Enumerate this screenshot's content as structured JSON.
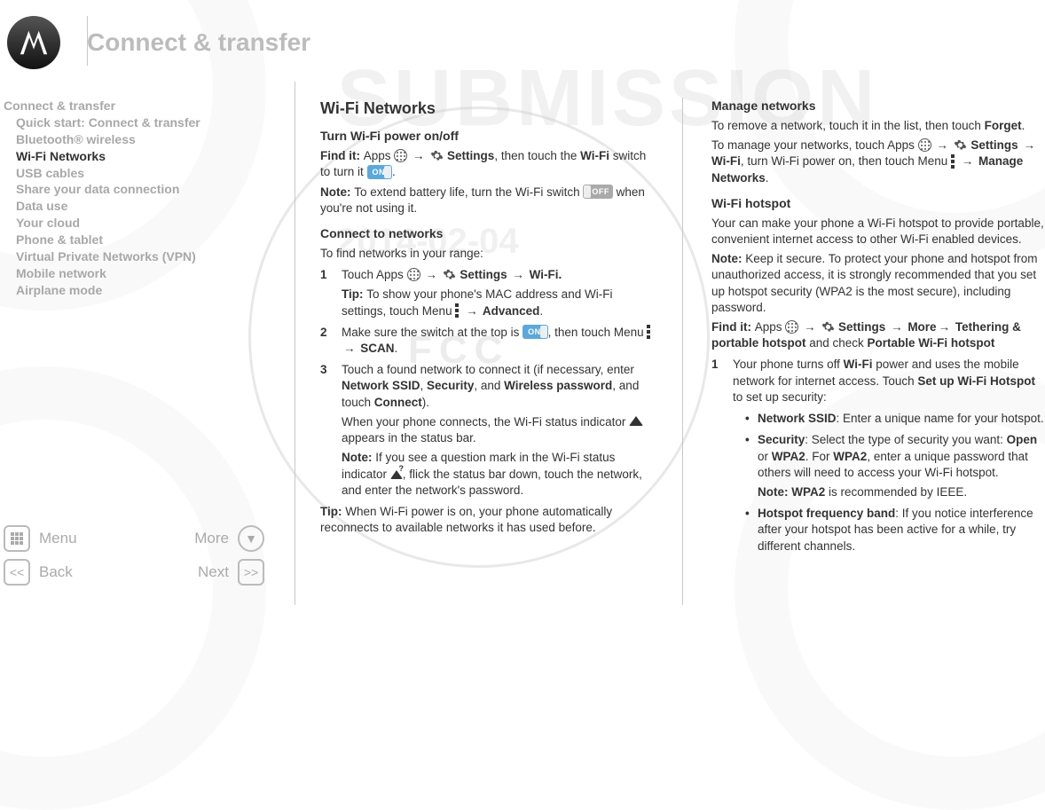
{
  "header": {
    "title": "Connect & transfer"
  },
  "watermarks": {
    "w1": "SUBMISSION",
    "w2": "2014-02-04",
    "w3": "FCC"
  },
  "toc": [
    {
      "label": "Connect & transfer",
      "level": "top"
    },
    {
      "label": "Quick start: Connect & transfer",
      "level": "sub"
    },
    {
      "label": "Bluetooth® wireless",
      "level": "sub"
    },
    {
      "label": "Wi-Fi Networks",
      "level": "sub",
      "active": true
    },
    {
      "label": "USB cables",
      "level": "sub"
    },
    {
      "label": "Share your data connection",
      "level": "sub"
    },
    {
      "label": "Data use",
      "level": "sub"
    },
    {
      "label": "Your cloud",
      "level": "sub"
    },
    {
      "label": "Phone & tablet",
      "level": "sub"
    },
    {
      "label": "Virtual Private Networks (VPN)",
      "level": "sub"
    },
    {
      "label": "Mobile network",
      "level": "sub"
    },
    {
      "label": "Airplane mode",
      "level": "sub"
    }
  ],
  "nav": {
    "menu": "Menu",
    "more": "More",
    "back": "Back",
    "next": "Next"
  },
  "switch": {
    "on": "ON",
    "off": "OFF"
  },
  "col1": {
    "h1": "Wi-Fi Networks",
    "h2a": "Turn Wi-Fi power on/off",
    "findit_pre": "Find it: ",
    "findit_apps": "Apps ",
    "findit_settings": " Settings",
    "findit_tail1": ", then touch the ",
    "findit_wifi": "Wi-Fi",
    "findit_tail2": " switch to turn it ",
    "findit_tail3": ".",
    "note1_pre": "Note: ",
    "note1_a": "To extend battery life, turn the Wi-Fi switch ",
    "note1_b": " when you're not using it.",
    "h2b": "Connect to networks",
    "p_find": "To find networks in your range:",
    "s1_a": "Touch Apps ",
    "s1_settings": " Settings ",
    "s1_wifi": " Wi-Fi.",
    "s1_tip_pre": "Tip: ",
    "s1_tip_a": "To show your phone's MAC address and Wi-Fi settings, touch Menu ",
    "s1_tip_adv": " Advanced",
    "s1_tip_end": ".",
    "s2_a": "Make sure the switch at the top is ",
    "s2_b": ", then touch Menu ",
    "s2_scan": " SCAN",
    "s2_end": ".",
    "s3_a": "Touch a found network to connect it (if necessary, enter ",
    "s3_ssid": "Network SSID",
    "s3_comma": ", ",
    "s3_sec": "Security",
    "s3_and": ", and ",
    "s3_pwd": "Wireless password",
    "s3_b": ", and touch ",
    "s3_connect": "Connect",
    "s3_end": ").",
    "s3_p2a": "When your phone connects, the Wi-Fi status indicator ",
    "s3_p2b": " appears in the status bar.",
    "s3_note_pre": "Note: ",
    "s3_note_a": "If you see a question mark in the Wi-Fi status indicator ",
    "s3_note_b": ", flick the status bar down, touch the network, and enter the network's password.",
    "tip2_pre": "Tip: ",
    "tip2_a": "When Wi-Fi power is on, your phone automatically reconnects to available networks it has used before."
  },
  "col2": {
    "h2a": "Manage networks",
    "p1_a": "To remove a network, touch it in the list, then touch ",
    "p1_forget": "Forget",
    "p1_end": ".",
    "p2_a": "To manage your networks, touch Apps ",
    "p2_settings": " Settings ",
    "p2_wifi": " Wi-Fi",
    "p2_b": ", turn Wi-Fi power on, then touch Menu ",
    "p2_manage": " Manage Networks",
    "p2_end": ".",
    "h2b": "Wi-Fi hotspot",
    "p3": "Your can make your phone a Wi-Fi hotspot to provide portable, convenient internet access to other Wi-Fi enabled devices.",
    "note_pre": "Note: ",
    "note_a": "Keep it secure. To protect your phone and hotspot from unauthorized access, it is strongly recommended that you set up hotspot security (WPA2 is the most secure), including password.",
    "findit_pre": "Find it: ",
    "findit_a": "Apps ",
    "findit_settings": " Settings ",
    "findit_more": " More",
    "findit_teth": " Tethering & portable hotspot",
    "findit_b": " and check ",
    "findit_port": "Portable Wi-Fi hotspot",
    "s1_a": "Your phone turns off ",
    "s1_wifi": "Wi-Fi",
    "s1_b": " power and uses the mobile network for internet access. Touch ",
    "s1_setup": "Set up Wi-Fi Hotspot",
    "s1_c": " to set up security:",
    "b1_ssid": "Network SSID",
    "b1_a": ": Enter a unique name for your hotspot.",
    "b2_sec": "Security",
    "b2_a": ": Select the type of security you want: ",
    "b2_open": "Open",
    "b2_or": " or ",
    "b2_wpa2": "WPA2",
    "b2_b": ". For ",
    "b2_wpa2b": "WPA2",
    "b2_c": ", enter a unique password that others will need to access your Wi-Fi hotspot.",
    "b2_note_pre": "Note: ",
    "b2_note_wpa2": "WPA2",
    "b2_note_a": " is recommended by IEEE.",
    "b3_freq": "Hotspot frequency band",
    "b3_a": ": If you notice interference after your hotspot has been active for a while, try different channels."
  }
}
